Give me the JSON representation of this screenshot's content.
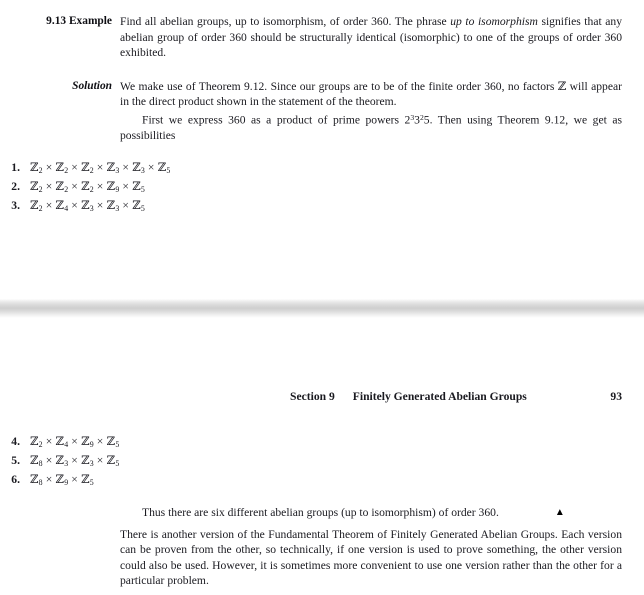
{
  "document": {
    "running_head": {
      "section": "Section 9",
      "title": "Finitely Generated Abelian Groups",
      "page_number": "93"
    },
    "example": {
      "label": "9.13 Example",
      "text_part1": "Find all abelian groups, up to isomorphism, of order 360. The phrase ",
      "emphasis": "up to isomorphism",
      "text_part2": " signifies that any abelian group of order 360 should be structurally identical (isomorphic) to one of the groups of order 360 exhibited."
    },
    "solution": {
      "label": "Solution",
      "paragraph1": "We make use of Theorem 9.12. Since our groups are to be of the finite order 360, no factors ℤ will appear in the direct product shown in the statement of the theorem.",
      "paragraph2_before": "First we express 360 as a product of prime powers 2",
      "exp1": "3",
      "paragraph2_mid1": "3",
      "exp2": "2",
      "paragraph2_mid2": "5. Then using Theorem 9.12, we get as possibilities",
      "conclusion": "Thus there are six different abelian groups (up to isomorphism) of order 360.",
      "end_marker": "▲",
      "closing_paragraph": "There is another version of the Fundamental Theorem of Finitely Generated Abelian Groups. Each version can be proven from the other, so technically, if one version is used to prove something, the other version could also be used. However, it is sometimes more convenient to use one version rather than the other for a particular problem."
    },
    "group_list": [
      {
        "number": "1.",
        "factors": [
          "2",
          "2",
          "2",
          "3",
          "3",
          "5"
        ]
      },
      {
        "number": "2.",
        "factors": [
          "2",
          "2",
          "2",
          "9",
          "5"
        ]
      },
      {
        "number": "3.",
        "factors": [
          "2",
          "4",
          "3",
          "3",
          "5"
        ]
      },
      {
        "number": "4.",
        "factors": [
          "2",
          "4",
          "9",
          "5"
        ]
      },
      {
        "number": "5.",
        "factors": [
          "8",
          "3",
          "3",
          "5"
        ]
      },
      {
        "number": "6.",
        "factors": [
          "8",
          "9",
          "5"
        ]
      }
    ],
    "symbols": {
      "integers_mod": "ℤ",
      "times": "×"
    },
    "colors": {
      "page_background": "#ffffff",
      "text": "#1a1a20",
      "separator": "#cfcfcf"
    }
  }
}
